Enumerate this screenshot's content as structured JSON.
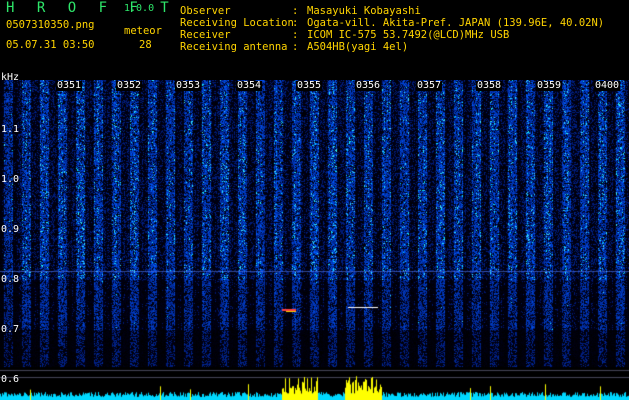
{
  "header": {
    "app_name": "H R O F F T",
    "version": "1.0.0",
    "file_name": "0507310350.png",
    "meteor_label": "meteor",
    "meteor_count": "28",
    "datetime": "05.07.31 03:50",
    "info": [
      {
        "label": "Observer",
        "value": "Masayuki Kobayashi"
      },
      {
        "label": "Receiving Location",
        "value": "Ogata-vill. Akita-Pref. JAPAN (139.96E, 40.02N)"
      },
      {
        "label": "Receiver",
        "value": "ICOM IC-575 53.7492(@LCD)MHz USB"
      },
      {
        "label": "Receiving antenna",
        "value": "A504HB(yagi 4el)"
      }
    ]
  },
  "spectrogram": {
    "y_unit": "kHz",
    "y_ticks": [
      "1.1",
      "1.0",
      "0.9",
      "0.8",
      "0.7",
      "0.6"
    ],
    "x_ticks": [
      "0351",
      "0352",
      "0353",
      "0354",
      "0355",
      "0356",
      "0357",
      "0358",
      "0359",
      "0400"
    ],
    "colors": {
      "background": "#000000",
      "signal": "#1e3cff",
      "label": "#ffffff",
      "header": "#ffd400",
      "title": "#2ee66a",
      "baseline": "#00e5ff",
      "echo": "#ffff00"
    }
  }
}
